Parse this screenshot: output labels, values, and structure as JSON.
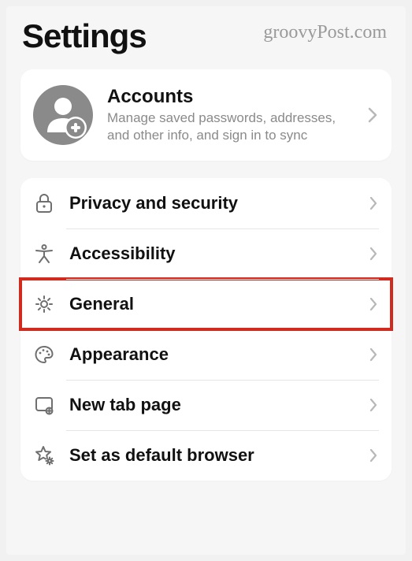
{
  "header": {
    "title": "Settings",
    "watermark": "groovyPost.com"
  },
  "account": {
    "title": "Accounts",
    "subtitle": "Manage saved passwords, addresses, and other info, and sign in to sync"
  },
  "menu": {
    "items": [
      {
        "label": "Privacy and security",
        "icon": "lock-icon",
        "highlighted": false
      },
      {
        "label": "Accessibility",
        "icon": "accessibility-icon",
        "highlighted": false
      },
      {
        "label": "General",
        "icon": "gear-icon",
        "highlighted": true
      },
      {
        "label": "Appearance",
        "icon": "palette-icon",
        "highlighted": false
      },
      {
        "label": "New tab page",
        "icon": "new-tab-icon",
        "highlighted": false
      },
      {
        "label": "Set as default browser",
        "icon": "star-gear-icon",
        "highlighted": false
      }
    ]
  }
}
